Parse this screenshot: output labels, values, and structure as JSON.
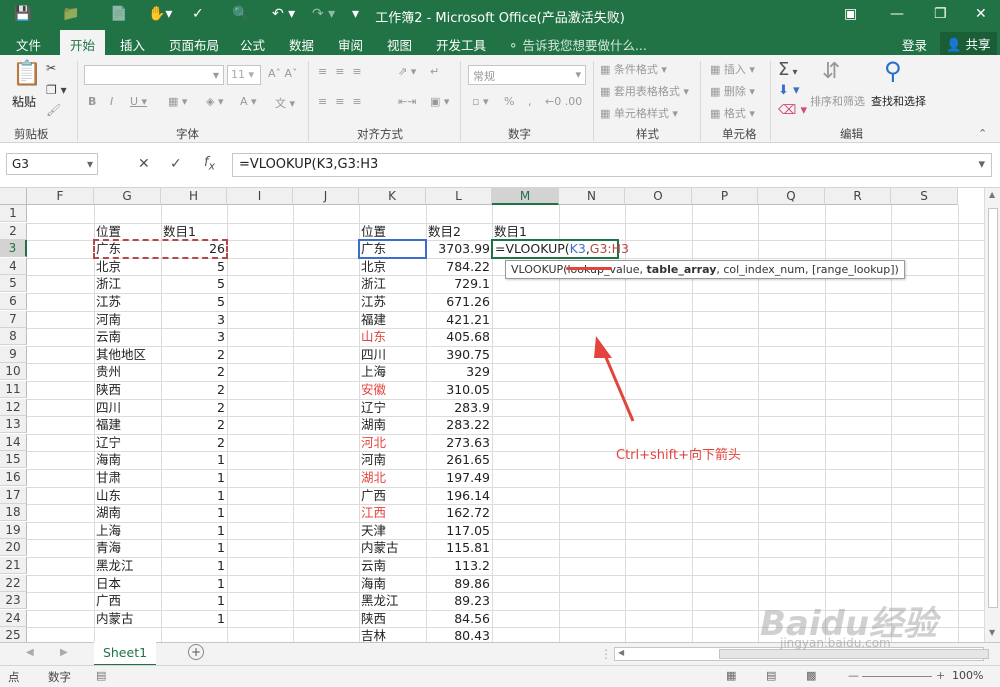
{
  "title": "工作簿2 - Microsoft Office(产品激活失败)",
  "menu": {
    "file": "文件",
    "home": "开始",
    "insert": "插入",
    "layout": "页面布局",
    "formula": "公式",
    "data": "数据",
    "review": "审阅",
    "view": "视图",
    "dev": "开发工具",
    "tellme": "告诉我您想要做什么...",
    "login": "登录",
    "share": "共享"
  },
  "ribbon": {
    "paste": "粘贴",
    "clipboard": "剪贴板",
    "font": "字体",
    "font_size": "11",
    "align": "对齐方式",
    "number_format": "常规",
    "number": "数字",
    "cond_format": "条件格式",
    "table_format": "套用表格格式",
    "cell_style": "单元格样式",
    "styles": "样式",
    "insert": "插入",
    "delete": "删除",
    "format": "格式",
    "cells": "单元格",
    "sort": "排序和筛选",
    "find": "查找和选择",
    "edit": "编辑"
  },
  "formula_bar": {
    "namebox": "G3",
    "formula": "=VLOOKUP(K3,G3:H3"
  },
  "columns": [
    "F",
    "G",
    "H",
    "I",
    "J",
    "K",
    "L",
    "M",
    "N",
    "O",
    "P",
    "Q",
    "R",
    "S"
  ],
  "rows": [
    "1",
    "2",
    "3",
    "4",
    "5",
    "6",
    "7",
    "8",
    "9",
    "10",
    "11",
    "12",
    "13",
    "14",
    "15",
    "16",
    "17",
    "18",
    "19",
    "20",
    "21",
    "22",
    "23",
    "24",
    "25"
  ],
  "table1": {
    "h1": "位置",
    "h2": "数目1",
    "names": [
      "广东",
      "北京",
      "浙江",
      "江苏",
      "河南",
      "云南",
      "其他地区",
      "贵州",
      "陕西",
      "四川",
      "福建",
      "辽宁",
      "海南",
      "甘肃",
      "山东",
      "湖南",
      "上海",
      "青海",
      "黑龙江",
      "日本",
      "广西",
      "内蒙古"
    ],
    "values": [
      "26",
      "5",
      "5",
      "5",
      "3",
      "3",
      "2",
      "2",
      "2",
      "2",
      "2",
      "2",
      "1",
      "1",
      "1",
      "1",
      "1",
      "1",
      "1",
      "1",
      "1",
      "1"
    ]
  },
  "table2": {
    "h1": "位置",
    "h2": "数目2",
    "h3": "数目1",
    "names": [
      "广东",
      "北京",
      "浙江",
      "江苏",
      "福建",
      "山东",
      "四川",
      "上海",
      "安徽",
      "辽宁",
      "湖南",
      "河北",
      "河南",
      "湖北",
      "广西",
      "江西",
      "天津",
      "内蒙古",
      "云南",
      "海南",
      "黑龙江",
      "陕西",
      "吉林"
    ],
    "values": [
      "3703.99",
      "784.22",
      "729.1",
      "671.26",
      "421.21",
      "405.68",
      "390.75",
      "329",
      "310.05",
      "283.9",
      "283.22",
      "273.63",
      "261.65",
      "197.49",
      "196.14",
      "162.72",
      "117.05",
      "115.81",
      "113.2",
      "89.86",
      "89.23",
      "84.56",
      "80.43"
    ]
  },
  "edit_cell": {
    "prefix": "=VLOOKUP(",
    "arg1": "K3",
    "comma": ",",
    "arg2": "G3:H3"
  },
  "tooltip": {
    "fn": "VLOOKUP(",
    "a1": "lookup_value",
    "a2": "table_array",
    "rest": ", col_index_num, [range_lookup])"
  },
  "annotation": "Ctrl+shift+向下箭头",
  "sheet_tab": "Sheet1",
  "status": {
    "mode": "点",
    "mode2": "数字",
    "zoom": "100%"
  },
  "watermark": "Baidu经验",
  "watermark_url": "jingyan.baidu.com",
  "colors": {
    "excel_green": "#217346",
    "red": "#e3443e",
    "ref_blue": "#3c6fcd",
    "ref_red": "#b5484b"
  }
}
